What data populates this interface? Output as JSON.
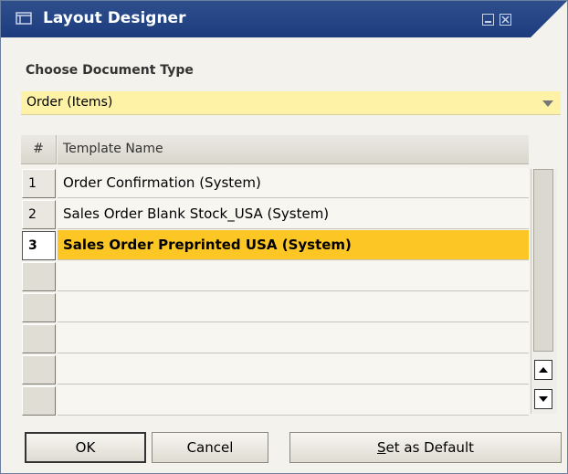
{
  "window": {
    "title": "Layout Designer",
    "icon": "layout-window-icon",
    "colors": {
      "titlebar": "#1c3c7e",
      "selected_row": "#fcc724",
      "dropdown": "#fdf2a6"
    }
  },
  "doc_type": {
    "label": "Choose Document Type",
    "value": "Order (Items)"
  },
  "grid": {
    "headers": {
      "num": "#",
      "name": "Template Name"
    },
    "rows": [
      {
        "num": "1",
        "name": "Order Confirmation (System)"
      },
      {
        "num": "2",
        "name": "Sales Order Blank Stock_USA (System)"
      },
      {
        "num": "3",
        "name": "Sales Order Preprinted USA (System)"
      }
    ],
    "selected_row": 3
  },
  "buttons": {
    "ok": "OK",
    "cancel": "Cancel",
    "default_first": "S",
    "default_rest": "et as Default"
  }
}
